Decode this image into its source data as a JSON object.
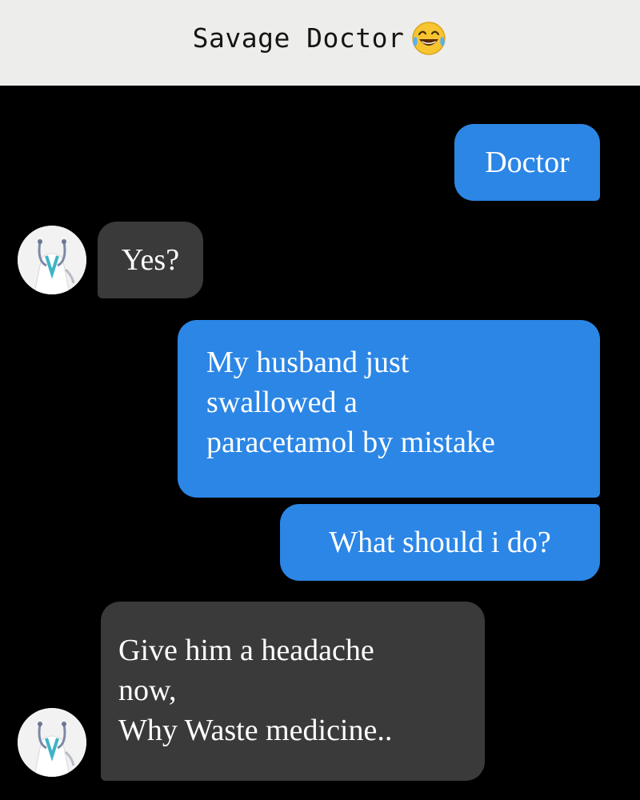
{
  "header": {
    "title": "Savage Doctor",
    "emoji": "tears-of-joy-emoji"
  },
  "colors": {
    "sent_bubble": "#2b86e6",
    "received_bubble": "#3a3a3a",
    "background": "#000000",
    "header_bg": "#ededeb"
  },
  "messages": [
    {
      "from": "me",
      "text": "Doctor"
    },
    {
      "from": "doctor",
      "text": "Yes?"
    },
    {
      "from": "me",
      "lines": [
        "My husband just",
        "swallowed a",
        "paracetamol by mistake"
      ]
    },
    {
      "from": "me",
      "text": "What should i do?"
    },
    {
      "from": "doctor",
      "lines": [
        "Give him a headache",
        "now,",
        "Why Waste medicine.."
      ]
    }
  ]
}
